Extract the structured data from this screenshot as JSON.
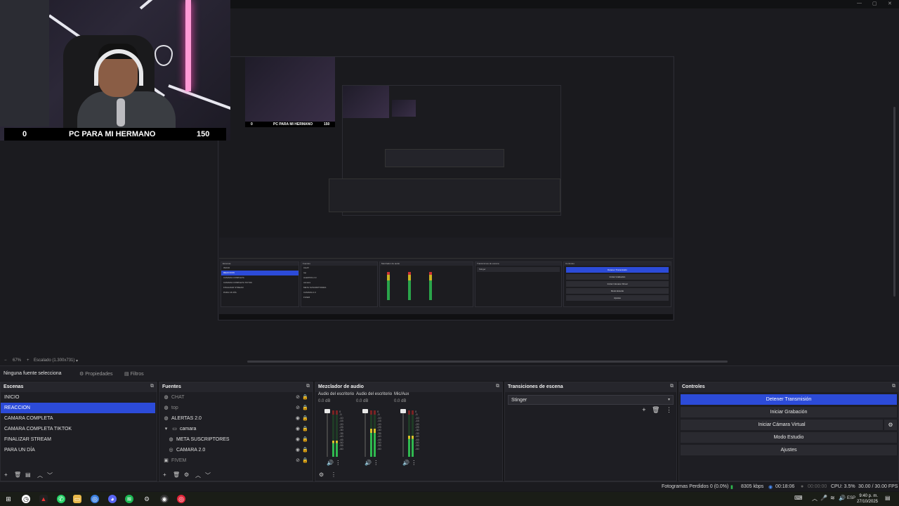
{
  "window": {
    "minimize": "—",
    "maximize": "▢",
    "close": "✕"
  },
  "overlay": {
    "goal_start": "0",
    "goal_title": "PC PARA MI HERMANO",
    "goal_target": "150"
  },
  "preview_nested": {
    "scenes": [
      "INICIO",
      "REACCION",
      "CAMARA COMPLETA",
      "CAMARA COMPLETA TIKTOK",
      "FINALIZAR STREAM",
      "PARA UN DÍA"
    ],
    "sources": [
      "CHAT",
      "top",
      "ALERTAS 2.0",
      "camara",
      "META SUSCRIPTORES",
      "CAMARA 2.0",
      "FIVEM"
    ],
    "controls": [
      "Detener Transmisión",
      "Iniciar Grabación",
      "Iniciar Cámara Virtual",
      "Modo Estudio",
      "Ajustes"
    ]
  },
  "zoombar": {
    "zoom": "67%",
    "scale": "Escalado (1.300x731)"
  },
  "propbar": {
    "no_source": "Ninguna fuente selecciona",
    "properties": "Propiedades",
    "filters": "Filtros"
  },
  "scenes": {
    "title": "Escenas",
    "items": [
      "INICIO",
      "REACCION",
      "CAMARA COMPLETA",
      "CAMARA COMPLETA TIKTOK",
      "FINALIZAR STREAM",
      "PARA UN DÍA"
    ],
    "selected_index": 1
  },
  "sources": {
    "title": "Fuentes",
    "items": [
      {
        "label": "CHAT",
        "icon": "globe-icon",
        "visible": false
      },
      {
        "label": "top",
        "icon": "globe-icon",
        "visible": false
      },
      {
        "label": "ALERTAS 2.0",
        "icon": "globe-icon",
        "visible": true
      },
      {
        "label": "camara",
        "icon": "folder-icon",
        "visible": true
      },
      {
        "label": "META SUSCRIPTORES",
        "icon": "browser-icon",
        "visible": true
      },
      {
        "label": "CAMARA 2.0",
        "icon": "camera-icon",
        "visible": true
      },
      {
        "label": "FIVEM",
        "icon": "image-icon",
        "visible": false
      }
    ]
  },
  "mixer": {
    "title": "Mezclador de audio",
    "channels": [
      {
        "name": "Audio del escritorio",
        "db": "0.0 dB",
        "level": 0.35
      },
      {
        "name": "Audio del escritorio",
        "db": "0.0 dB",
        "level": 0.6
      },
      {
        "name": "Mic/Aux",
        "db": "0.0 dB",
        "level": 0.45
      }
    ],
    "scale": [
      "0",
      "-5",
      "-10",
      "-15",
      "-20",
      "-25",
      "-30",
      "-35",
      "-40",
      "-45",
      "-50",
      "-55",
      "-60"
    ]
  },
  "transitions": {
    "title": "Transiciones de escena",
    "selected": "Stinger"
  },
  "controls": {
    "title": "Controles",
    "stop_stream": "Detener Transmisión",
    "start_recording": "Iniciar Grabación",
    "start_virtual_cam": "Iniciar Cámara Virtual",
    "studio_mode": "Modo Estudio",
    "settings": "Ajustes"
  },
  "status": {
    "dropped_frames": "Fotogramas Perdidos 0 (0.0%)",
    "bitrate": "8305 kbps",
    "stream_time": "00:18:06",
    "rec_time": "00:00:00",
    "cpu": "CPU: 3.5%",
    "fps": "30.00 / 30.00 FPS"
  },
  "taskbar": {
    "lang": "ESP",
    "time": "9:40 p. m.",
    "date": "27/10/2025"
  },
  "colors": {
    "accent": "#2c4bd8",
    "bg": "#1e1e23",
    "meter_green": "#2fb94f"
  }
}
